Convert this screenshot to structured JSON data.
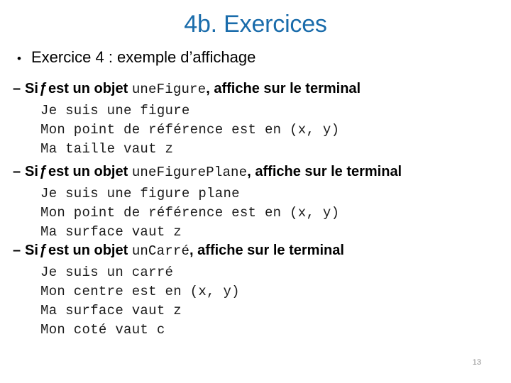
{
  "slide": {
    "title": "4b. Exercices",
    "title_color": "#1a6cab",
    "background_color": "#ffffff",
    "page_number": "13"
  },
  "bullet": {
    "marker": "•",
    "text": "Exercice 4 : exemple d’affichage"
  },
  "blocks": [
    {
      "dash": "–",
      "head_prefix": "Si",
      "head_italic": "ƒ",
      "head_middle": "est un objet",
      "code_name": "uneFigure",
      "head_suffix": ", affiche sur le terminal",
      "lines": [
        "Je suis une figure",
        "Mon point de référence est en (x, y)",
        "Ma taille vaut z"
      ]
    },
    {
      "dash": "–",
      "head_prefix": "Si",
      "head_italic": "ƒ",
      "head_middle": "est un objet",
      "code_name": "uneFigurePlane",
      "head_suffix": ", affiche sur le terminal",
      "lines": [
        "Je suis une figure plane",
        "Mon point de référence est en (x, y)",
        "Ma surface vaut z"
      ]
    },
    {
      "dash": "–",
      "head_prefix": "Si",
      "head_italic": "ƒ",
      "head_middle": "est un objet",
      "code_name": "unCarré",
      "head_suffix": ", affiche sur le terminal",
      "lines": [
        "Je suis un carré",
        "Mon centre est en (x, y)",
        "Ma surface vaut z",
        "Mon coté vaut c"
      ]
    }
  ]
}
